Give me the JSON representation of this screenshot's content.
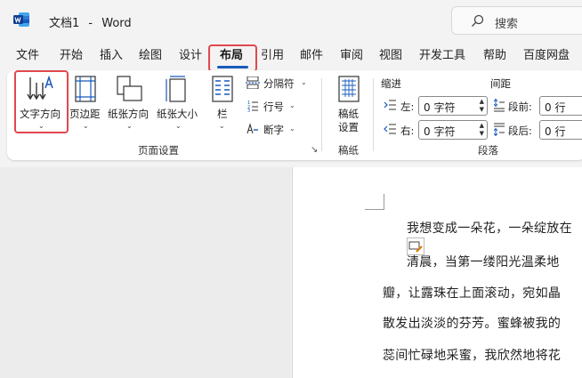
{
  "titlebar": {
    "doc_name": "文档1",
    "separator": "-",
    "app_name": "Word",
    "search_placeholder": "搜索"
  },
  "tabs": [
    {
      "label": "文件"
    },
    {
      "label": "开始"
    },
    {
      "label": "插入"
    },
    {
      "label": "绘图"
    },
    {
      "label": "设计"
    },
    {
      "label": "布局"
    },
    {
      "label": "引用"
    },
    {
      "label": "邮件"
    },
    {
      "label": "审阅"
    },
    {
      "label": "视图"
    },
    {
      "label": "开发工具"
    },
    {
      "label": "帮助"
    },
    {
      "label": "百度网盘"
    }
  ],
  "ribbon": {
    "page_setup": {
      "text_direction": "文字方向",
      "margins": "页边距",
      "orientation": "纸张方向",
      "size": "纸张大小",
      "columns": "栏",
      "breaks": "分隔符",
      "line_numbers": "行号",
      "hyphenation": "断字",
      "group_title": "页面设置"
    },
    "manuscript": {
      "button_line1": "稿纸",
      "button_line2": "设置",
      "group_title": "稿纸"
    },
    "paragraph": {
      "indent_title": "缩进",
      "spacing_title": "间距",
      "left_label": "左:",
      "left_value": "0 字符",
      "right_label": "右:",
      "right_value": "0 字符",
      "before_label": "段前:",
      "before_value": "0 行",
      "after_label": "段后:",
      "after_value": "0 行",
      "group_title": "段落"
    }
  },
  "document": {
    "lines": [
      "我想变成一朵花，一朵绽放在",
      "清晨，当第一缕阳光温柔地",
      "瓣，让露珠在上面滚动，宛如晶",
      "散发出淡淡的芬芳。蜜蜂被我的",
      "蕊间忙碌地采蜜，我欣然地将花"
    ]
  },
  "colors": {
    "accent": "#185abd",
    "highlight": "#e0484d"
  }
}
